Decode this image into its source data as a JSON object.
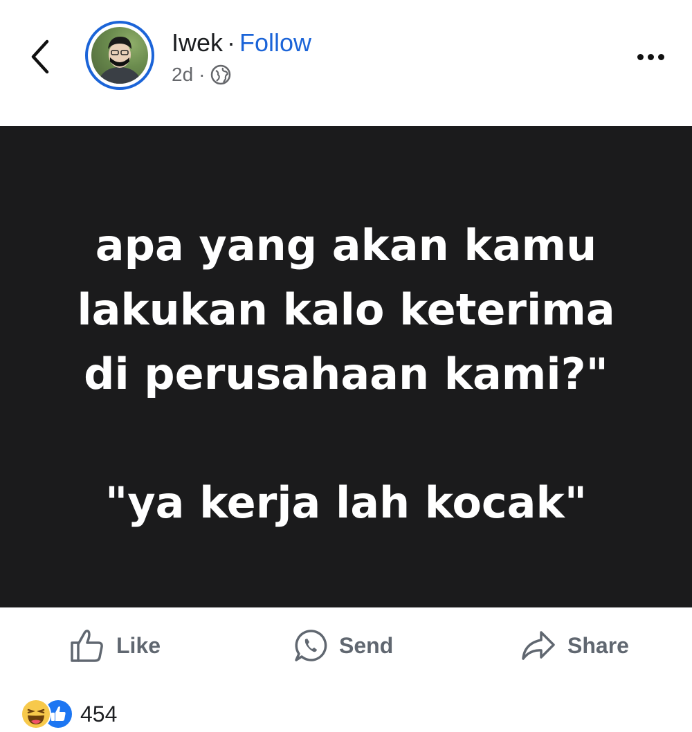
{
  "header": {
    "name": "Iwek",
    "separator": "·",
    "follow_label": "Follow",
    "time": "2d",
    "time_separator": "·",
    "privacy_icon": "globe-icon"
  },
  "post": {
    "lines": [
      "apa yang akan kamu",
      "lakukan kalo keterima",
      "di perusahaan kami?\"",
      "\"ya kerja lah kocak\""
    ]
  },
  "actions": {
    "like_label": "Like",
    "send_label": "Send",
    "share_label": "Share"
  },
  "reactions": {
    "count": "454",
    "icons": [
      "haha-reaction-icon",
      "like-reaction-icon"
    ]
  },
  "colors": {
    "accent": "#1b64d8",
    "post_background": "#1b1b1c",
    "action_text": "#606770"
  }
}
